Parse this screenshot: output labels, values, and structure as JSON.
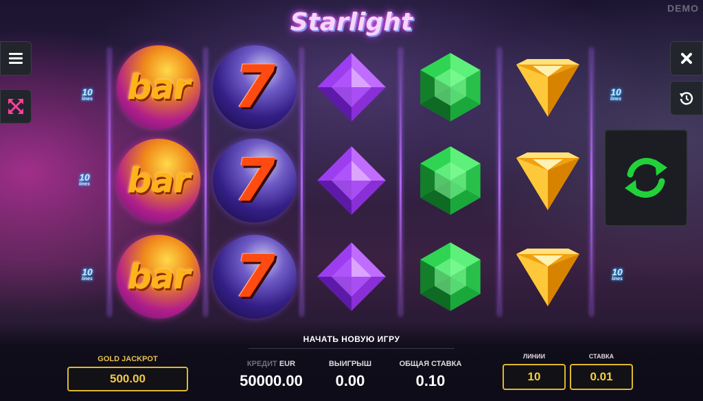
{
  "demo_label": "DEMO",
  "game_title": "Starlight",
  "icons": {
    "menu": "hamburger-icon",
    "fullscreen": "fullscreen-arrows-icon",
    "close": "close-icon",
    "history": "history-clock-icon",
    "spin": "refresh-arrows-icon"
  },
  "reels": [
    {
      "symbol": "bar",
      "rows": [
        "bar",
        "bar",
        "bar"
      ]
    },
    {
      "symbol": "seven",
      "rows": [
        "7",
        "7",
        "7"
      ]
    },
    {
      "symbol": "purple-gem",
      "rows": [
        "purple-gem",
        "purple-gem",
        "purple-gem"
      ]
    },
    {
      "symbol": "green-gem",
      "rows": [
        "green-gem",
        "green-gem",
        "green-gem"
      ]
    },
    {
      "symbol": "yellow-gem",
      "rows": [
        "yellow-gem",
        "yellow-gem",
        "yellow-gem"
      ]
    }
  ],
  "line_badges": {
    "number": "10",
    "word": "lines"
  },
  "new_game_label": "НАЧАТЬ НОВУЮ ИГРУ",
  "gold_jackpot": {
    "label": "GOLD JACKPOT",
    "value": "500.00"
  },
  "credit": {
    "label": "КРЕДИТ",
    "currency": "EUR",
    "value": "50000.00"
  },
  "win": {
    "label": "ВЫИГРЫШ",
    "value": "0.00"
  },
  "total_bet": {
    "label": "ОБЩАЯ СТАВКА",
    "value": "0.10"
  },
  "lines": {
    "label": "ЛИНИИ",
    "value": "10"
  },
  "bet": {
    "label": "СТАВКА",
    "value": "0.01"
  },
  "colors": {
    "accent_gold": "#e0b930",
    "spin_green": "#22d13a",
    "fullscreen_pink": "#ff3fa0",
    "panel_bg": "#0e0c18"
  }
}
